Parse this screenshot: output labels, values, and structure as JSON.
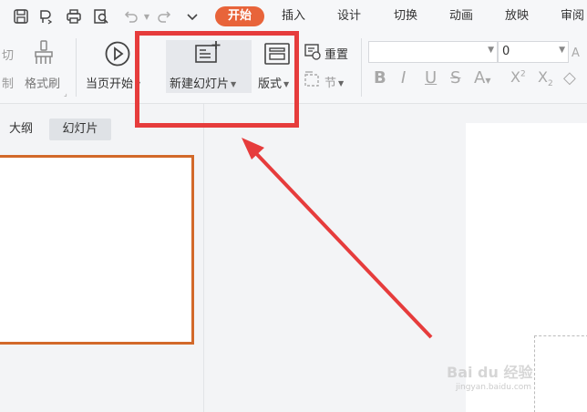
{
  "menu": {
    "tabs": [
      "开始",
      "插入",
      "设计",
      "切换",
      "动画",
      "放映",
      "审阅"
    ]
  },
  "ribbon": {
    "cut_partial": "切",
    "copy_partial": "制",
    "format_painter": "格式刷",
    "play_current": "当页开始",
    "new_slide": "新建幻灯片",
    "layout": "版式",
    "reset": "重置",
    "section": "节",
    "font_name": "",
    "font_size": "0"
  },
  "panel": {
    "tabs": [
      "大纲",
      "幻灯片"
    ]
  },
  "watermark": {
    "main": "Bai du 经验",
    "sub": "jingyan.baidu.com"
  },
  "colors": {
    "accent": "#e8643a",
    "annotation": "#e63c3c",
    "thumb_border": "#d2692a"
  }
}
